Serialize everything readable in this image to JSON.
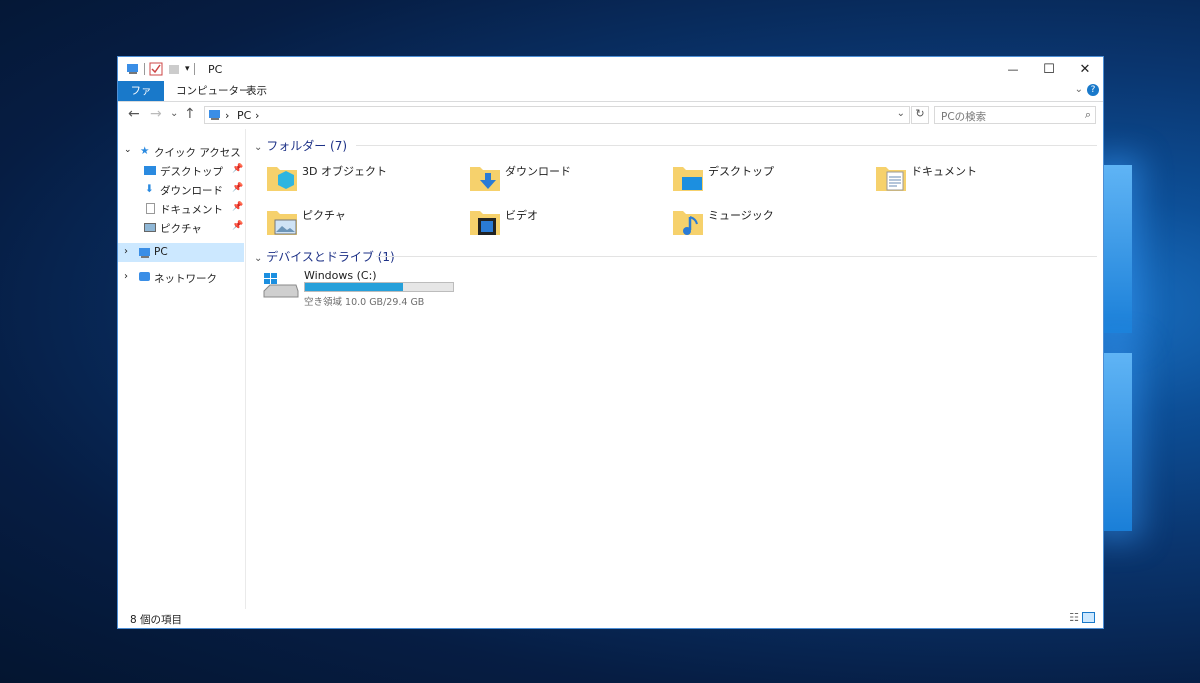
{
  "window": {
    "title": "PC",
    "minimize_glyph": "—",
    "maximize_glyph": "☐",
    "close_glyph": "✕"
  },
  "ribbon": {
    "tabs": [
      "ファイル",
      "コンピューター",
      "表示"
    ]
  },
  "address": {
    "path": "PC",
    "separator": "›",
    "search_placeholder": "PCの検索"
  },
  "nav": {
    "quick_access": "クイック アクセス",
    "quick_items": [
      "デスクトップ",
      "ダウンロード",
      "ドキュメント",
      "ピクチャ"
    ],
    "pc": "PC",
    "network": "ネットワーク"
  },
  "main": {
    "folders_header": "フォルダー (7)",
    "folders": [
      {
        "label": "3D オブジェクト",
        "icon": "3d-objects-icon"
      },
      {
        "label": "ダウンロード",
        "icon": "downloads-icon"
      },
      {
        "label": "デスクトップ",
        "icon": "desktop-icon"
      },
      {
        "label": "ドキュメント",
        "icon": "documents-icon"
      },
      {
        "label": "ピクチャ",
        "icon": "pictures-icon"
      },
      {
        "label": "ビデオ",
        "icon": "videos-icon"
      },
      {
        "label": "ミュージック",
        "icon": "music-icon"
      }
    ],
    "drives_header": "デバイスとドライブ (1)",
    "drive": {
      "name": "Windows (C:)",
      "free_text": "空き領域 10.0 GB/29.4 GB",
      "used_fraction": 0.66
    }
  },
  "status": {
    "item_count": "8 個の項目"
  },
  "colors": {
    "accent": "#1979ca",
    "folder": "#f6d16c",
    "drive_bar": "#26a0da"
  }
}
